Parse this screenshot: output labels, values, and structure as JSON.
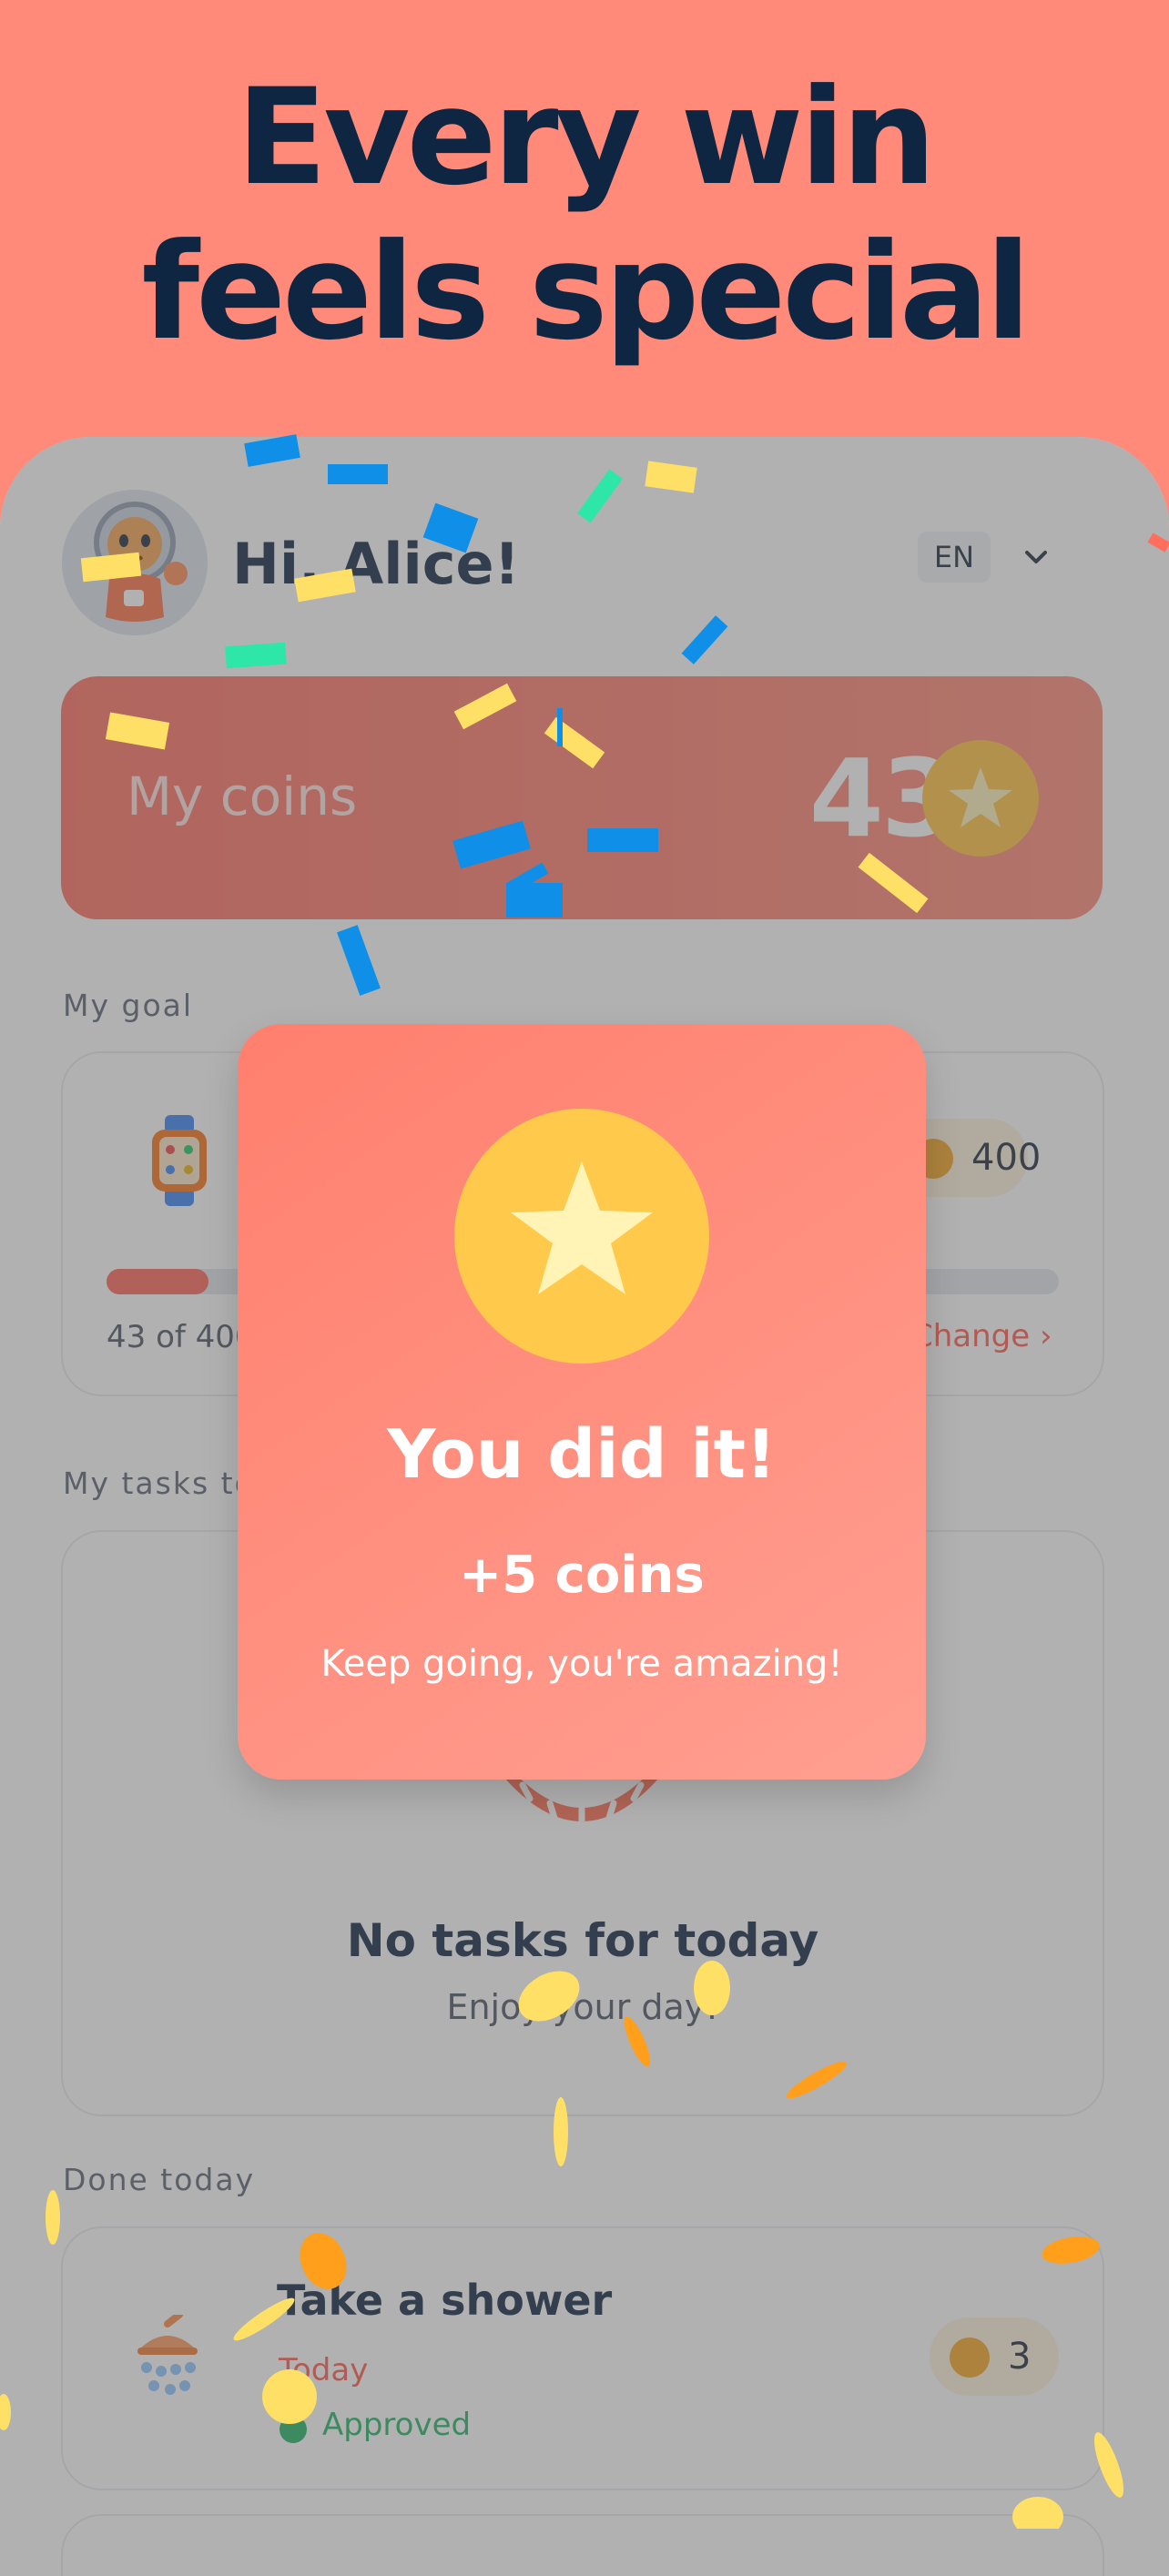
{
  "hero": {
    "line1": "Every win",
    "line2": "feels special"
  },
  "header": {
    "greeting": "Hi, Alice!",
    "language": "EN"
  },
  "coins": {
    "label": "My coins",
    "value": "43"
  },
  "goal": {
    "section_label": "My goal",
    "price": "400",
    "progress_text": "43 of 400",
    "progress_fraction": 0.1075,
    "change_label": "Change"
  },
  "tasks": {
    "section_label": "My tasks today",
    "empty_title": "No tasks for today",
    "empty_subtitle": "Enjoy your day!"
  },
  "done": {
    "section_label": "Done today",
    "items": [
      {
        "title": "Take a shower",
        "day": "Today",
        "status": "Approved",
        "coins": "3"
      }
    ]
  },
  "modal": {
    "title": "You did it!",
    "coins": "+5 coins",
    "message": "Keep going, you're amazing!"
  },
  "colors": {
    "hero_bg": "#ff8a7a",
    "dark_text": "#0f2642",
    "accent": "#ff6658",
    "coin": "#ffc23d",
    "success": "#22b466"
  }
}
